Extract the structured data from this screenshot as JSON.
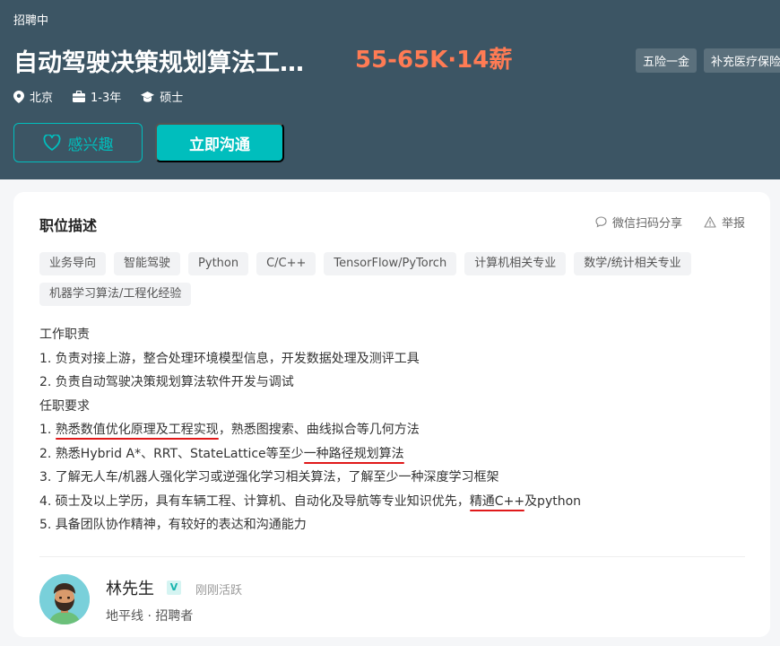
{
  "header": {
    "status": "招聘中",
    "title": "自动驾驶决策规划算法工程师",
    "salary": "55-65K·14薪",
    "benefits": [
      "五险一金",
      "补充医疗保险"
    ],
    "location": "北京",
    "experience": "1-3年",
    "degree": "硕士",
    "interest_label": "感兴趣",
    "chat_label": "立即沟通"
  },
  "card": {
    "title": "职位描述",
    "share_label": "微信扫码分享",
    "report_label": "举报",
    "tags": [
      "业务导向",
      "智能驾驶",
      "Python",
      "C/C++",
      "TensorFlow/PyTorch",
      "计算机相关专业",
      "数学/统计相关专业",
      "机器学习算法/工程化经验"
    ],
    "description": {
      "duties_heading": "工作职责",
      "duty1": "1. 负责对接上游，整合处理环境模型信息，开发数据处理及测评工具",
      "duty2": "2. 负责自动驾驶决策规划算法软件开发与调试",
      "req_heading": "任职要求",
      "req1_prefix": "1. ",
      "req1_marked": "熟悉数值优化原理及工程实现",
      "req1_suffix": "，熟悉图搜索、曲线拟合等几何方法",
      "req2_prefix": "2. ",
      "req2_marked_a": "熟悉Hybrid A*、RRT、StateLattice等至少",
      "req2_marked_b": "一种路径规划算法",
      "req3": "3. 了解无人车/机器人强化学习或逆强化学习相关算法，了解至少一种深度学习框架",
      "req4_prefix": "4. 硕士及以上学历，具有车辆工程、计算机、自动化及导航等专业知识优先，",
      "req4_marked": "精通C++",
      "req4_suffix": "及python",
      "req5": "5. 具备团队协作精神，有较好的表达和沟通能力"
    }
  },
  "recruiter": {
    "name": "林先生",
    "badge": "V",
    "active": "刚刚活跃",
    "company": "地平线 · 招聘者"
  },
  "colors": {
    "header_bg": "#3c5564",
    "accent": "#00bebd",
    "salary": "#ff7b54",
    "underline": "#e0191a"
  }
}
